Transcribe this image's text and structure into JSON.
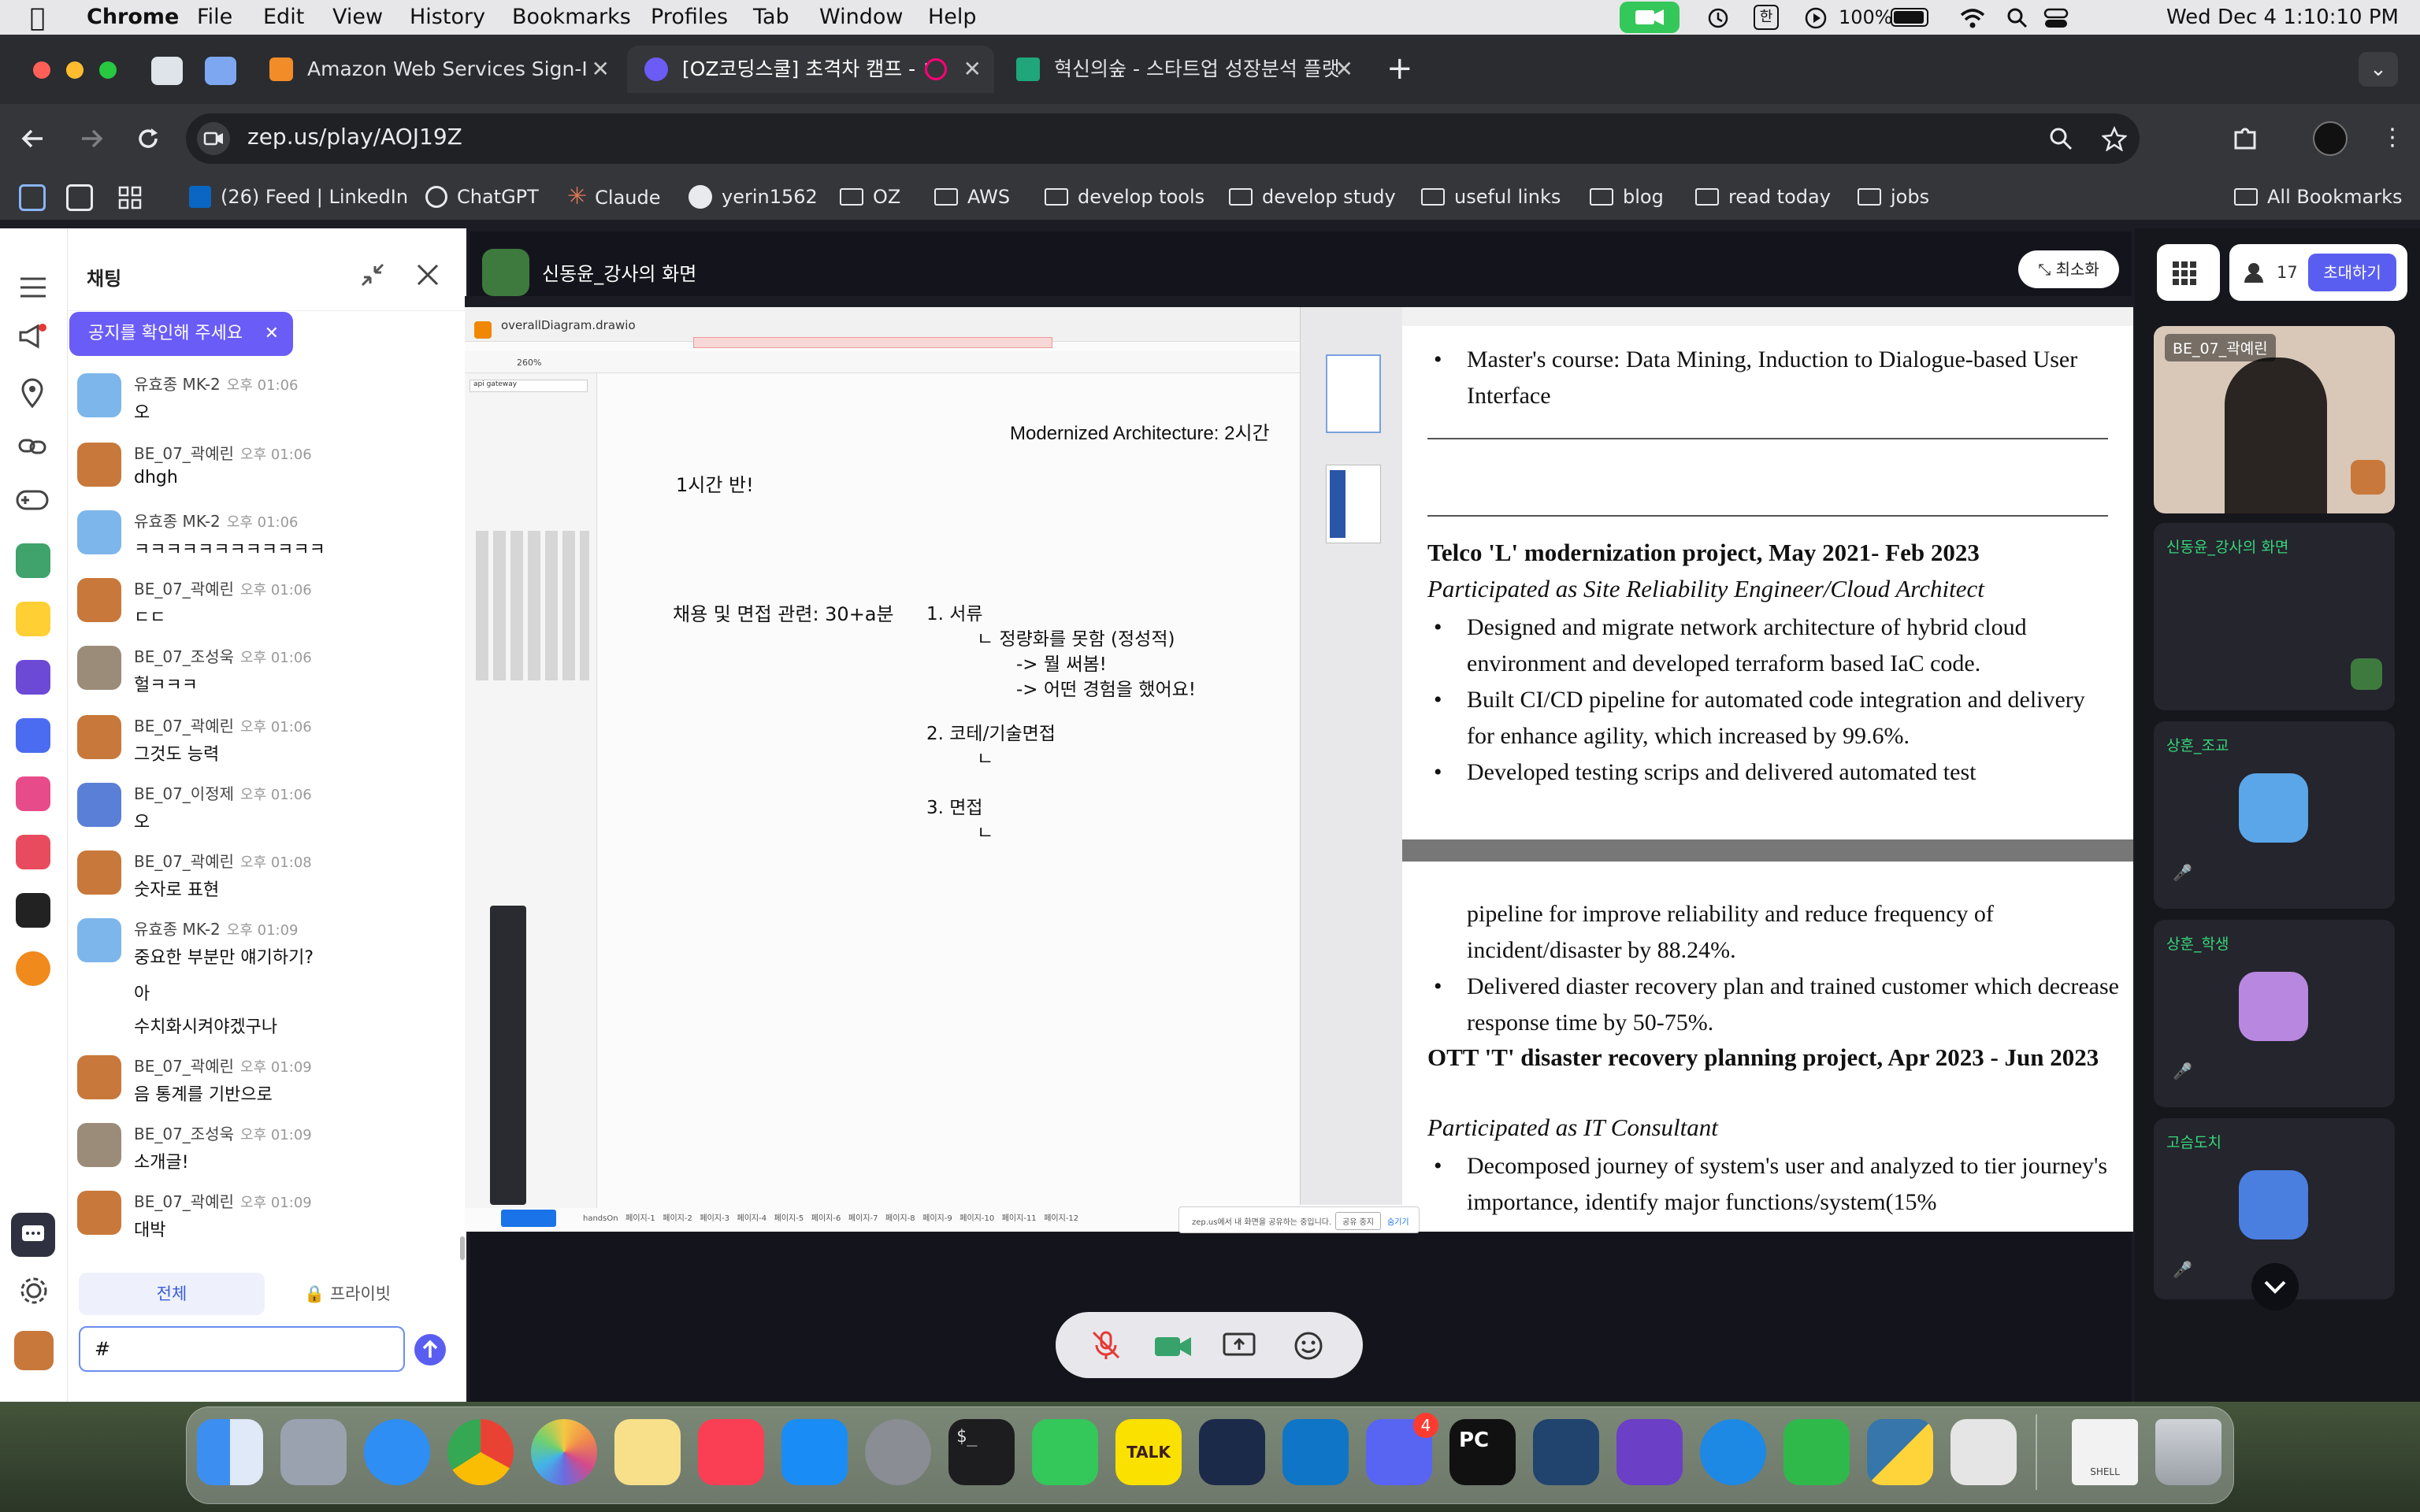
{
  "menubar": {
    "app": "Chrome",
    "menus": [
      "File",
      "Edit",
      "View",
      "History",
      "Bookmarks",
      "Profiles",
      "Tab",
      "Window",
      "Help"
    ],
    "battery": "100%",
    "datetime": "Wed Dec 4  1:10:10 PM",
    "ime": "한"
  },
  "tabs": [
    {
      "title": "Amazon Web Services Sign-I"
    },
    {
      "title": "[OZ코딩스쿨] 초격차 캠프 - ㅂ"
    },
    {
      "title": "혁신의숲 - 스타트업 성장분석 플랫"
    }
  ],
  "address": {
    "url": "zep.us/play/AOJ19Z"
  },
  "bookmarks": {
    "linkedin": "(26) Feed | LinkedIn",
    "chatgpt": "ChatGPT",
    "claude": "Claude",
    "github": "yerin1562",
    "folders": [
      "OZ",
      "AWS",
      "develop tools",
      "develop study",
      "useful links",
      "blog",
      "read today",
      "jobs"
    ],
    "all": "All Bookmarks"
  },
  "chat": {
    "title": "채팅",
    "notice": "공지를 확인해 주세요",
    "messages": [
      {
        "name": "유효종 MK-2",
        "time": "오후 01:06",
        "text": "오"
      },
      {
        "name": "BE_07_곽예린",
        "time": "오후 01:06",
        "text": "dhgh"
      },
      {
        "name": "유효종 MK-2",
        "time": "오후 01:06",
        "text": "ㅋㅋㅋㅋㅋㅋㅋㅋㅋㅋㅋㅋ"
      },
      {
        "name": "BE_07_곽예린",
        "time": "오후 01:06",
        "text": "ㄷㄷ"
      },
      {
        "name": "BE_07_조성욱",
        "time": "오후 01:06",
        "text": "헐ㅋㅋㅋ"
      },
      {
        "name": "BE_07_곽예린",
        "time": "오후 01:06",
        "text": "그것도 능력"
      },
      {
        "name": "BE_07_이정제",
        "time": "오후 01:06",
        "text": "오"
      },
      {
        "name": "BE_07_곽예린",
        "time": "오후 01:08",
        "text": "숫자로 표현"
      },
      {
        "name": "유효종 MK-2",
        "time": "오후 01:09",
        "text": "중요한 부분만 얘기하기?",
        "extra": [
          "아",
          "수치화시켜야겠구나"
        ]
      },
      {
        "name": "BE_07_곽예린",
        "time": "오후 01:09",
        "text": "음 통계를 기반으로"
      },
      {
        "name": "BE_07_조성욱",
        "time": "오후 01:09",
        "text": "소개글!"
      },
      {
        "name": "BE_07_곽예린",
        "time": "오후 01:09",
        "text": "대박"
      }
    ],
    "tab_all": "전체",
    "tab_private": "프라이빗",
    "input_value": "#"
  },
  "screen": {
    "title": "신동윤_강사의 화면",
    "minimize": "최소화",
    "drawio": {
      "filename": "overallDiagram.drawio",
      "zoom": "260%",
      "search": "api gateway",
      "heading": "Modernized Architecture: 2시간",
      "note1": "1시간 반!",
      "note2": "채용 및 면접 관련: 30+a분",
      "list": [
        "1. 서류",
        "ㄴ 정량화를 못함 (정성적)",
        "-> 뭘 써봄!",
        "-> 어떤 경험을 했어요!",
        "2. 코테/기술면접",
        "ㄴ",
        "3. 면접",
        "ㄴ"
      ],
      "pages": [
        "handsOn",
        "페이지-1",
        "페이지-2",
        "페이지-3",
        "페이지-4",
        "페이지-5",
        "페이지-6",
        "페이지-7",
        "페이지-8",
        "페이지-9",
        "페이지-10",
        "페이지-11",
        "페이지-12"
      ],
      "share_notice": "zep.us에서 내 화면을 공유하는 중입니다.",
      "share_stop": "공유 중지",
      "share_hide": "숨기기"
    },
    "resume": {
      "master": "Master's course: Data Mining, Induction to Dialogue-based User Interface",
      "proj1_title": "Telco 'L' modernization project, May 2021- Feb 2023",
      "proj1_role": "Participated as Site Reliability Engineer/Cloud Architect",
      "proj1_bullets": [
        "Designed and migrate network architecture of hybrid cloud environment and developed terraform based IaC code.",
        "Built CI/CD pipeline for automated code integration and delivery for enhance agility, which increased by 99.6%.",
        "Developed testing scrips and delivered automated test"
      ],
      "cont": "pipeline for improve reliability and reduce frequency of incident/disaster by 88.24%.",
      "bullet4": "Delivered diaster recovery plan and trained customer which decrease response time by 50-75%.",
      "proj2_title": "OTT 'T' disaster recovery planning project, Apr 2023 - Jun 2023",
      "proj2_role": "Participated as IT Consultant",
      "bullet5": "Decomposed journey of system's user and analyzed to tier journey's importance, identify major functions/system(15%"
    }
  },
  "participants": {
    "count": "17",
    "invite": "초대하기",
    "tiles": [
      "BE_07_곽예린",
      "신동윤_강사의 화면",
      "상훈_조교",
      "상훈_학생",
      "고슴도치"
    ]
  },
  "dock": {
    "discord_badge": "4",
    "kakao": "TALK",
    "shell": "SHELL"
  }
}
